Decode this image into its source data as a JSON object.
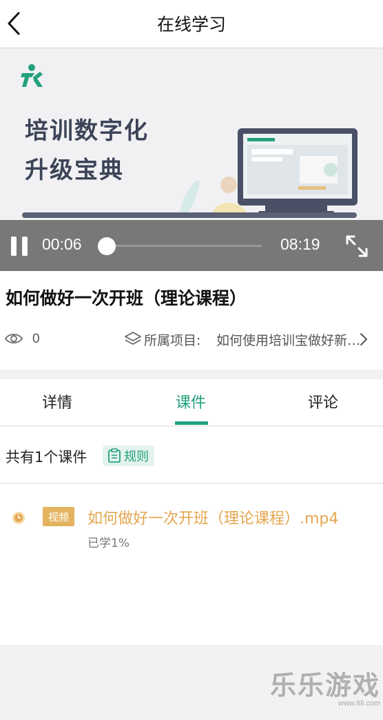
{
  "header": {
    "title": "在线学习"
  },
  "video": {
    "promo_line1": "培训数字化",
    "promo_line2": "升级宝典",
    "current_time": "00:06",
    "duration": "08:19",
    "progress_fraction": 0.012
  },
  "course": {
    "title": "如何做好一次开班（理论课程）",
    "views": "0",
    "project_label": "所属项目:",
    "project_name": "如何使用培训宝做好新员工培训"
  },
  "tabs": [
    {
      "label": "详情",
      "active": false
    },
    {
      "label": "课件",
      "active": true
    },
    {
      "label": "评论",
      "active": false
    }
  ],
  "courseware": {
    "count_text": "共有1个课件",
    "rules_label": "规则",
    "items": [
      {
        "badge": "视频",
        "title": "如何做好一次开班（理论课程）.mp4",
        "progress": "已学1%"
      }
    ]
  },
  "watermark": {
    "big": "乐乐游戏",
    "small": "www.6ll.com"
  },
  "colors": {
    "accent": "#23a07e",
    "item_orange": "#e4a750",
    "badge_bg": "#e4b35f"
  }
}
